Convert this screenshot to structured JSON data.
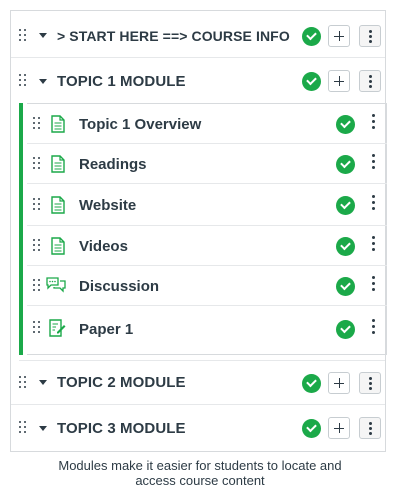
{
  "colors": {
    "accent": "#1ba949",
    "text": "#2d3b45",
    "border": "#d7dadd"
  },
  "modules": [
    {
      "title": "> START HERE ==> COURSE INFO",
      "expanded": false,
      "published": true
    },
    {
      "title": "TOPIC 1 MODULE",
      "expanded": true,
      "published": true
    },
    {
      "title": "TOPIC 2 MODULE",
      "expanded": false,
      "published": true
    },
    {
      "title": "TOPIC 3 MODULE",
      "expanded": false,
      "published": true
    }
  ],
  "topic1_items": [
    {
      "title": "Topic 1 Overview",
      "icon": "document-icon",
      "published": true
    },
    {
      "title": "Readings",
      "icon": "document-icon",
      "published": true
    },
    {
      "title": "Website",
      "icon": "document-icon",
      "published": true
    },
    {
      "title": "Videos",
      "icon": "document-icon",
      "published": true
    },
    {
      "title": "Discussion",
      "icon": "discussion-icon",
      "published": true
    },
    {
      "title": "Paper 1",
      "icon": "assignment-icon",
      "published": true
    }
  ],
  "caption": {
    "line1": "Modules make it easier for students to locate and",
    "line2": "access course content"
  }
}
